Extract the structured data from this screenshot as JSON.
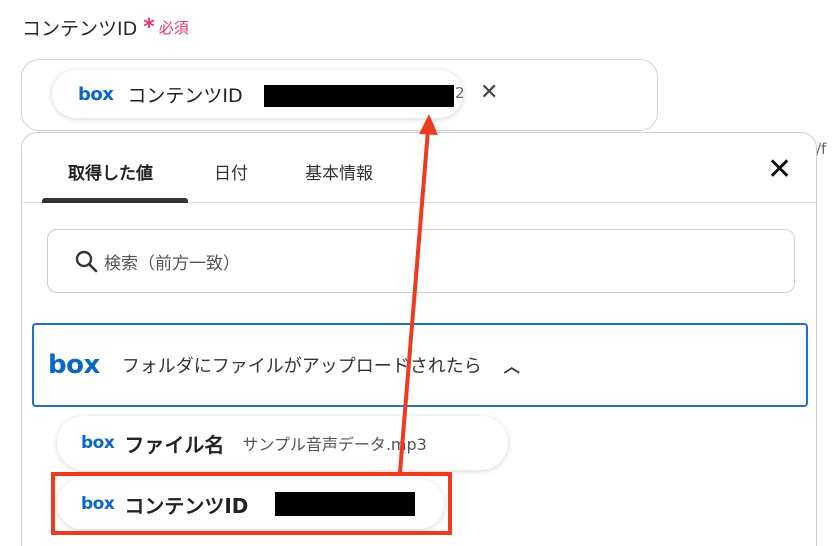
{
  "field": {
    "label": "コンテンツID",
    "required_star": "*",
    "required_text": "必須"
  },
  "selected_chip": {
    "logo": "box",
    "label": "コンテンツID",
    "tail": "2",
    "close_icon": "close-icon"
  },
  "side_text": "/f",
  "popup": {
    "tabs": [
      {
        "label": "取得した値",
        "active": true
      },
      {
        "label": "日付",
        "active": false
      },
      {
        "label": "基本情報",
        "active": false
      }
    ],
    "close_icon": "close-icon",
    "search": {
      "placeholder": "検索（前方一致）",
      "icon": "search-icon"
    },
    "section": {
      "logo": "box",
      "title": "フォルダにファイルがアップロードされたら",
      "chevron": "chevron-up-icon"
    },
    "items": [
      {
        "logo": "box",
        "label": "ファイル名",
        "value": "サンプル音声データ.mp3"
      },
      {
        "logo": "box",
        "label": "コンテンツID",
        "value": ""
      }
    ]
  },
  "annotation": {
    "color": "#ee3b1f"
  }
}
